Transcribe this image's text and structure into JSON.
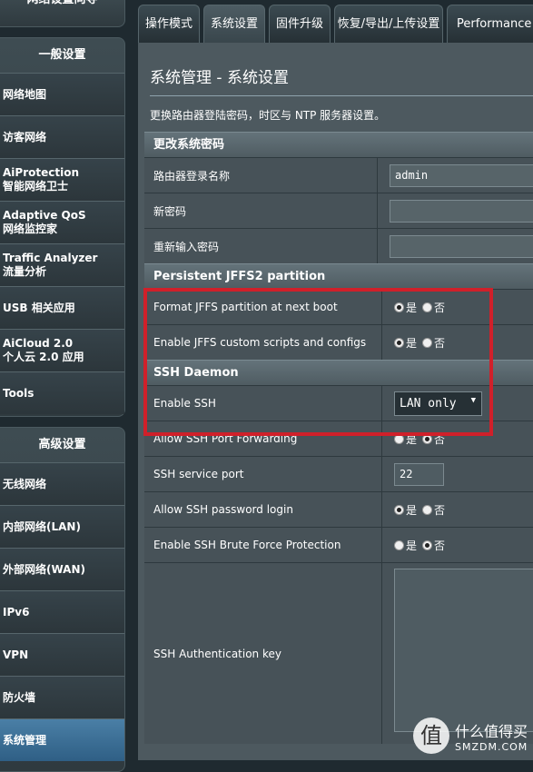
{
  "sidebar": {
    "top_partial": "网络设置向导",
    "group1": {
      "header": "一般设置",
      "items": [
        {
          "lines": [
            "网络地图"
          ]
        },
        {
          "lines": [
            "访客网络"
          ]
        },
        {
          "lines": [
            "AiProtection",
            "智能网络卫士"
          ]
        },
        {
          "lines": [
            "Adaptive QoS",
            "网络监控家"
          ]
        },
        {
          "lines": [
            "Traffic Analyzer",
            "流量分析"
          ]
        },
        {
          "lines": [
            "USB 相关应用"
          ]
        },
        {
          "lines": [
            "AiCloud 2.0",
            "个人云 2.0 应用"
          ]
        },
        {
          "lines": [
            "Tools"
          ]
        }
      ]
    },
    "group2": {
      "header": "高级设置",
      "items": [
        {
          "lines": [
            "无线网络"
          ]
        },
        {
          "lines": [
            "内部网络(LAN)"
          ]
        },
        {
          "lines": [
            "外部网络(WAN)"
          ]
        },
        {
          "lines": [
            "IPv6"
          ]
        },
        {
          "lines": [
            "VPN"
          ]
        },
        {
          "lines": [
            "防火墙"
          ]
        },
        {
          "lines": [
            "系统管理"
          ]
        }
      ]
    }
  },
  "tabs": [
    "操作模式",
    "系统设置",
    "固件升级",
    "恢复/导出/上传设置",
    "Performance t"
  ],
  "active_tab": 1,
  "main": {
    "title": "系统管理 - 系统设置",
    "description": "更换路由器登陆密码，时区与 NTP 服务器设置。",
    "sections": {
      "password": {
        "header": "更改系统密码",
        "login_name_label": "路由器登录名称",
        "login_name_value": "admin",
        "new_password_label": "新密码",
        "retype_password_label": "重新输入密码"
      },
      "jffs": {
        "header": "Persistent JFFS2 partition",
        "format_label": "Format JFFS partition at next boot",
        "scripts_label": "Enable JFFS custom scripts and configs"
      },
      "ssh": {
        "header": "SSH Daemon",
        "enable_label": "Enable SSH",
        "enable_value": "LAN only",
        "forwarding_label": "Allow SSH Port Forwarding",
        "port_label": "SSH service port",
        "port_value": "22",
        "password_login_label": "Allow SSH password login",
        "brute_label": "Enable SSH Brute Force Protection",
        "auth_key_label": "SSH Authentication key"
      }
    },
    "radio_yes": "是",
    "radio_no": "否"
  },
  "watermark": {
    "logo_char": "值",
    "line1": "什么值得买",
    "line2": "SMZDM.COM"
  },
  "colors": {
    "highlight": "#d0202a",
    "active_sidebar": "#2f5f85"
  }
}
